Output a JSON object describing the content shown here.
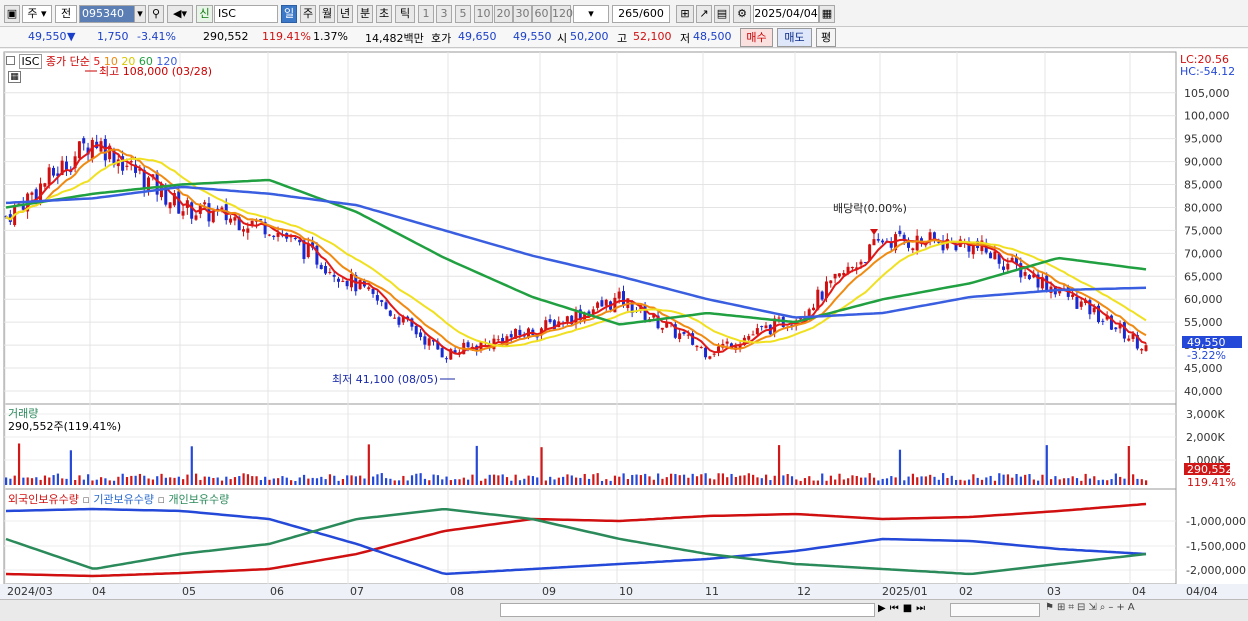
{
  "toolbar": {
    "market": "주",
    "scope": "전",
    "code": "095340",
    "badge": "신",
    "name": "ISC",
    "periods": [
      "일",
      "주",
      "월",
      "년",
      "분",
      "초",
      "틱"
    ],
    "numbers": [
      "1",
      "3",
      "5",
      "10",
      "20",
      "30",
      "60",
      "120"
    ],
    "count": "265",
    "count_total": "/600",
    "date": "2025/04/04"
  },
  "quote": {
    "price": "49,550",
    "change_arrow": "▼",
    "change": "1,750",
    "change_pct": "-3.41%",
    "volume": "290,552",
    "volume_ratio": "119.41%",
    "turnover": "1.37%",
    "amount": "14,482백만",
    "ask_label": "호가",
    "ask1": "49,650",
    "ask2": "49,550",
    "open_label": "시",
    "open": "50,200",
    "high_label": "고",
    "high": "52,100",
    "low_label": "저",
    "low": "48,500",
    "buy": "매수",
    "sell": "매도",
    "eval": "평"
  },
  "price_panel": {
    "title": "ISC",
    "ma_label": "종가 단순",
    "ma_periods": [
      "5",
      "10",
      "20",
      "60",
      "120"
    ],
    "max_label": "최고 108,000 (03/28)",
    "min_label": "최저 41,100 (08/05)",
    "dividend_label": "배당락(0.00%)",
    "lc": "LC:20.56",
    "hc": "HC:-54.12",
    "current": "49,550",
    "current_pct": "-3.22%",
    "y_ticks": [
      "105,000",
      "100,000",
      "95,000",
      "90,000",
      "85,000",
      "80,000",
      "75,000",
      "70,000",
      "65,000",
      "60,000",
      "55,000",
      "50,000",
      "45,000",
      "40,000"
    ],
    "colors": {
      "ma5": "#e01818",
      "ma10": "#f08a10",
      "ma20": "#f0e020",
      "ma60": "#20a040",
      "ma120": "#3a5ee0"
    }
  },
  "volume_panel": {
    "title": "거래량",
    "info": "290,552주(119.41%)",
    "y_ticks": [
      "3,000K",
      "2,000K",
      "1,000K"
    ],
    "current": "290,552",
    "current_pct": "119.41%"
  },
  "holder_panel": {
    "legend": [
      "외국인보유수량",
      "기관보유수량",
      "개인보유수량"
    ],
    "y_ticks": [
      "-1,000,000",
      "-1,500,000",
      "-2,000,000"
    ]
  },
  "x_axis": [
    "2024/03",
    "04",
    "05",
    "06",
    "07",
    "08",
    "09",
    "10",
    "11",
    "12",
    "2025/01",
    "02",
    "03",
    "04"
  ],
  "x_axis_right": "04/04",
  "chart_data": {
    "type": "line",
    "x": [
      "2024/03",
      "2024/04",
      "2024/05",
      "2024/06",
      "2024/07",
      "2024/08",
      "2024/09",
      "2024/10",
      "2024/11",
      "2024/12",
      "2025/01",
      "2025/02",
      "2025/03",
      "2025/04"
    ],
    "series": [
      {
        "name": "종가",
        "values": [
          78000,
          95000,
          80000,
          76000,
          63000,
          48000,
          53000,
          60000,
          48500,
          56000,
          73000,
          72000,
          62000,
          49550
        ]
      },
      {
        "name": "120",
        "values": [
          81000,
          82000,
          84500,
          83000,
          80500,
          75000,
          69500,
          65000,
          60000,
          56000,
          57000,
          60500,
          62000,
          62500
        ]
      },
      {
        "name": "60",
        "values": [
          80000,
          83000,
          85000,
          86000,
          79000,
          69000,
          60500,
          54500,
          57000,
          55000,
          60000,
          63500,
          69000,
          66500
        ]
      }
    ],
    "ylim": [
      40000,
      108000
    ]
  }
}
